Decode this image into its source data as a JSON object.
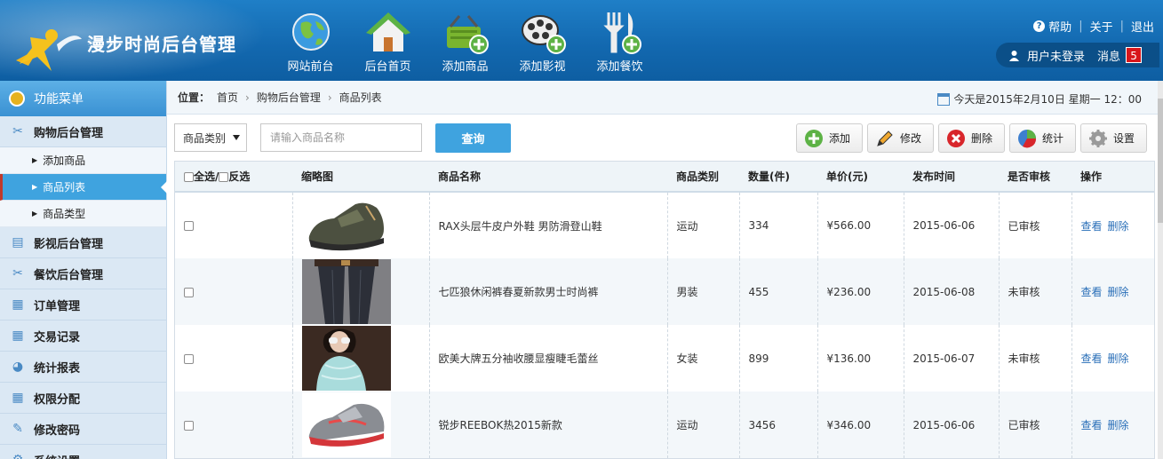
{
  "app": {
    "brand": "漫步时尚后台管理",
    "nav": [
      {
        "label": "网站前台",
        "icon": "globe-icon"
      },
      {
        "label": "后台首页",
        "icon": "home-icon"
      },
      {
        "label": "添加商品",
        "icon": "basket-add-icon"
      },
      {
        "label": "添加影视",
        "icon": "film-add-icon"
      },
      {
        "label": "添加餐饮",
        "icon": "cutlery-add-icon"
      }
    ],
    "toplinks": {
      "help": "帮助",
      "about": "关于",
      "logout": "退出"
    },
    "user": {
      "status": "用户未登录",
      "msg_label": "消息",
      "msg_count": "5"
    }
  },
  "sidebar": {
    "title": "功能菜单",
    "groups": [
      {
        "label": "购物后台管理",
        "icon": "shop-icon"
      },
      {
        "label": "影视后台管理",
        "icon": "film-icon"
      },
      {
        "label": "餐饮后台管理",
        "icon": "cutlery-icon"
      },
      {
        "label": "订单管理",
        "icon": "calendar-icon"
      },
      {
        "label": "交易记录",
        "icon": "calendar-icon"
      },
      {
        "label": "统计报表",
        "icon": "pie-icon"
      },
      {
        "label": "权限分配",
        "icon": "calendar-icon"
      },
      {
        "label": "修改密码",
        "icon": "pen-icon"
      },
      {
        "label": "系统设置",
        "icon": "gear-icon"
      }
    ],
    "subs": [
      {
        "label": "添加商品"
      },
      {
        "label": "商品列表"
      },
      {
        "label": "商品类型"
      }
    ]
  },
  "breadcrumb": {
    "prefix": "位置：",
    "items": [
      "首页",
      "购物后台管理",
      "商品列表"
    ]
  },
  "today": "今天是2015年2月10日 星期一 12：00",
  "toolbar": {
    "category_select": "商品类别",
    "search_placeholder": "请输入商品名称",
    "query": "查询",
    "actions": [
      "添加",
      "修改",
      "删除",
      "统计",
      "设置"
    ]
  },
  "table": {
    "headers": {
      "select_all": "全选/",
      "invert": "反选",
      "thumb": "缩略图",
      "name": "商品名称",
      "category": "商品类别",
      "qty": "数量(件)",
      "price": "单价(元)",
      "date": "发布时间",
      "audit": "是否审核",
      "ops": "操作"
    },
    "rows": [
      {
        "name": "RAX头层牛皮户外鞋 男防滑登山鞋",
        "category": "运动",
        "qty": "334",
        "price": "¥566.00",
        "date": "2015-06-06",
        "audit": "已审核",
        "view": "查看",
        "del": "删除",
        "thumb": "hiking-shoe-image"
      },
      {
        "name": "七匹狼休闲裤春夏新款男士时尚裤",
        "category": "男装",
        "qty": "455",
        "price": "¥236.00",
        "date": "2015-06-08",
        "audit": "未审核",
        "view": "查看",
        "del": "删除",
        "thumb": "trousers-image"
      },
      {
        "name": "欧美大牌五分袖收腰显瘦睫毛蕾丝",
        "category": "女装",
        "qty": "899",
        "price": "¥136.00",
        "date": "2015-06-07",
        "audit": "未审核",
        "view": "查看",
        "del": "删除",
        "thumb": "lace-top-image"
      },
      {
        "name": "锐步REEBOK热2015新款",
        "category": "运动",
        "qty": "3456",
        "price": "¥346.00",
        "date": "2015-06-06",
        "audit": "已审核",
        "view": "查看",
        "del": "删除",
        "thumb": "running-shoe-image"
      }
    ]
  },
  "colors": {
    "header": "#1369b0",
    "accent": "#3fa3df",
    "link": "#2a6fb8",
    "badge": "#d8161b"
  }
}
